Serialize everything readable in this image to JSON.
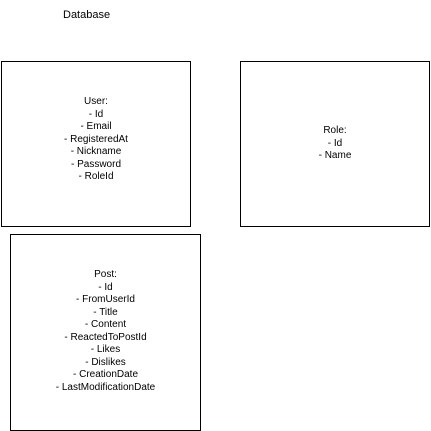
{
  "diagram_title": "Database",
  "entities": {
    "user": {
      "name": "User:",
      "fields": [
        "- Id",
        "- Email",
        "- RegisteredAt",
        "- Nickname",
        "- Password",
        "- RoleId"
      ]
    },
    "role": {
      "name": "Role:",
      "fields": [
        "- Id",
        "- Name"
      ]
    },
    "post": {
      "name": "Post:",
      "fields": [
        "- Id",
        "- FromUserId",
        "- Title",
        "- Content",
        "- ReactedToPostId",
        "- Likes",
        "- Dislikes",
        "- CreationDate",
        "- LastModificationDate"
      ]
    }
  }
}
